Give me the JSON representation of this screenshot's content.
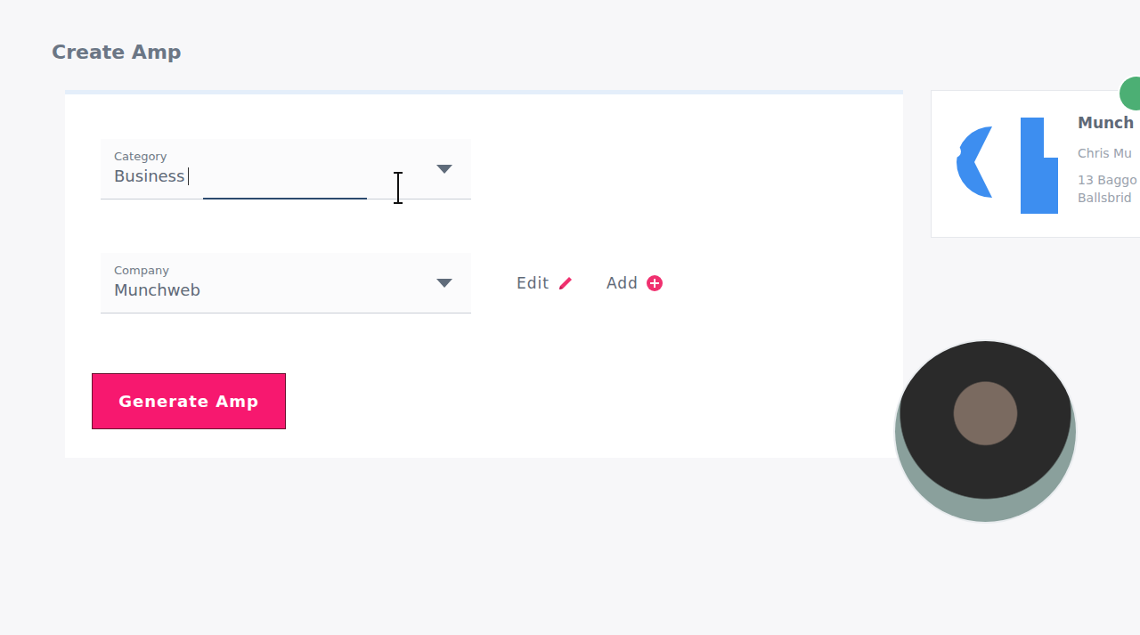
{
  "title": "Create Amp",
  "fields": [
    {
      "label": "Category",
      "value": "Business",
      "focused": true
    },
    {
      "label": "Company",
      "value": "Munchweb",
      "focused": false
    }
  ],
  "company_actions": [
    {
      "label": "Edit",
      "kind": "edit"
    },
    {
      "label": "Add",
      "kind": "add"
    }
  ],
  "generate_button": "Generate Amp",
  "company_card": {
    "name": "Munch",
    "contact": "Chris Mu",
    "address": [
      "13 Baggo",
      "Ballsbrid"
    ]
  }
}
